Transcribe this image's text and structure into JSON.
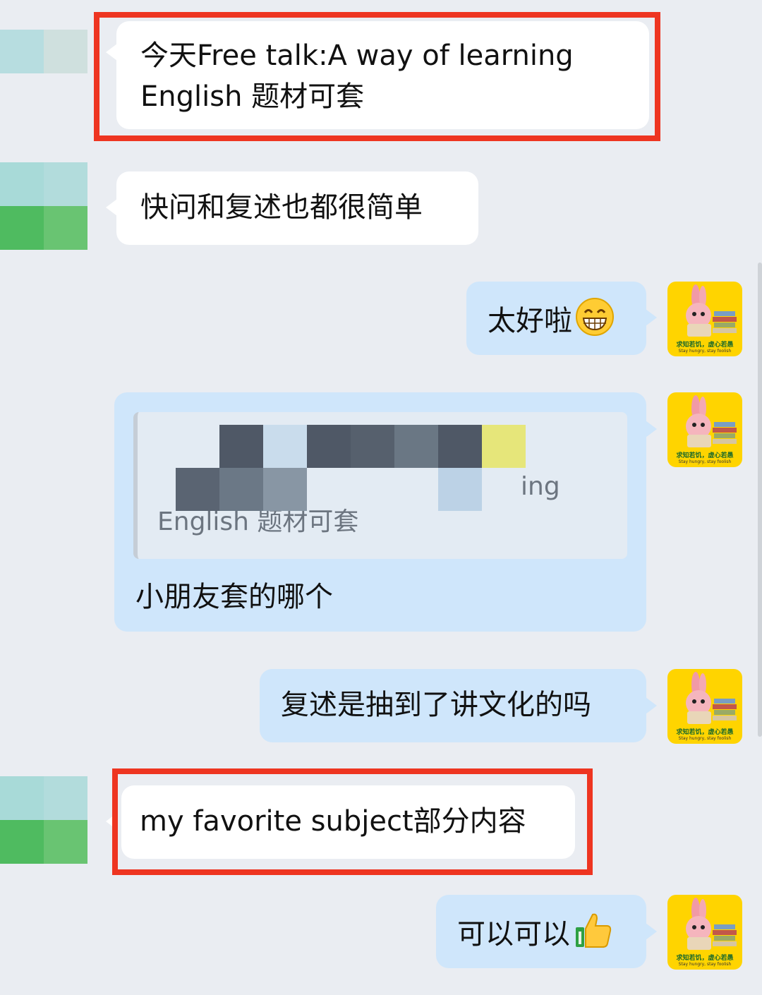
{
  "messages": [
    {
      "side": "in",
      "text_line1": "今天Free talk:A way of learning",
      "text_line2": "English 题材可套"
    },
    {
      "side": "in",
      "text": "快问和复述也都很简单"
    },
    {
      "side": "out",
      "text": "太好啦",
      "emoji": "grinning-face-emoji"
    },
    {
      "side": "out",
      "quote": {
        "visible_fragment": "ing",
        "line2": "English 题材可套"
      },
      "text": "小朋友套的哪个"
    },
    {
      "side": "out",
      "text": "复述是抽到了讲文化的吗"
    },
    {
      "side": "in",
      "text": "my favorite subject部分内容"
    },
    {
      "side": "out",
      "text": "可以可以",
      "emoji": "thumbs-up-emoji"
    }
  ],
  "avatar": {
    "caption1": "求知若饥，虚心若愚",
    "caption2": "Stay hungry, stay foolish"
  },
  "colors": {
    "background": "#eaedf2",
    "incoming_bubble": "#ffffff",
    "outgoing_bubble": "#cfe6fb",
    "highlight_box": "#ee3521",
    "avatar_bg": "#ffd400"
  }
}
